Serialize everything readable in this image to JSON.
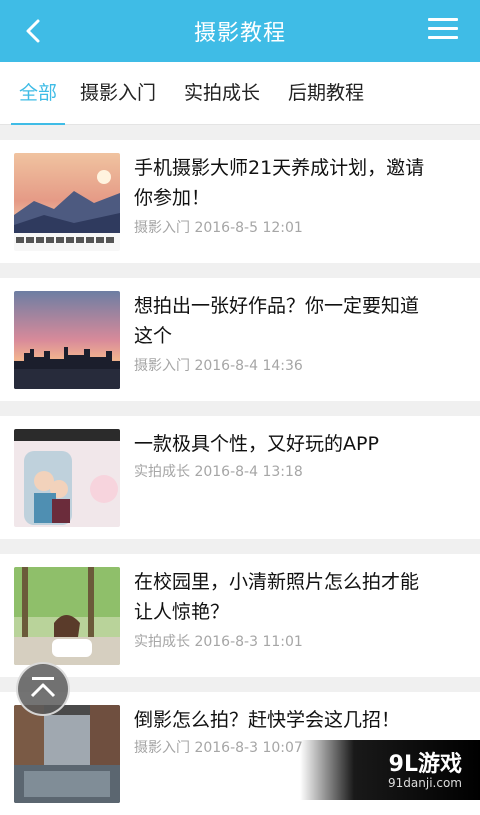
{
  "header": {
    "title": "摄影教程"
  },
  "tabs": [
    {
      "label": "全部",
      "active": true
    },
    {
      "label": "摄影入门",
      "active": false
    },
    {
      "label": "实拍成长",
      "active": false
    },
    {
      "label": "后期教程",
      "active": false
    }
  ],
  "articles": [
    {
      "title_l1": "手机摄影大师21天养成计划，邀请",
      "title_l2": "你参加！",
      "category": "摄影入门",
      "date": "2016-8-5 12:01"
    },
    {
      "title_l1": "想拍出一张好作品？你一定要知道",
      "title_l2": "这个",
      "category": "摄影入门",
      "date": "2016-8-4 14:36"
    },
    {
      "title_l1": "一款极具个性，又好玩的APP",
      "title_l2": "",
      "category": "实拍成长",
      "date": "2016-8-4 13:18"
    },
    {
      "title_l1": "在校园里，小清新照片怎么拍才能",
      "title_l2": "让人惊艳？",
      "category": "实拍成长",
      "date": "2016-8-3 11:01"
    },
    {
      "title_l1": "倒影怎么拍？赶快学会这几招！",
      "title_l2": "",
      "category": "摄影入门",
      "date": "2016-8-3 10:07"
    }
  ],
  "watermark": {
    "brand": "9L游戏",
    "site": "91danji.com"
  },
  "colors": {
    "accent": "#3fbce6",
    "meta": "#a6a6a6",
    "title": "#111111"
  }
}
